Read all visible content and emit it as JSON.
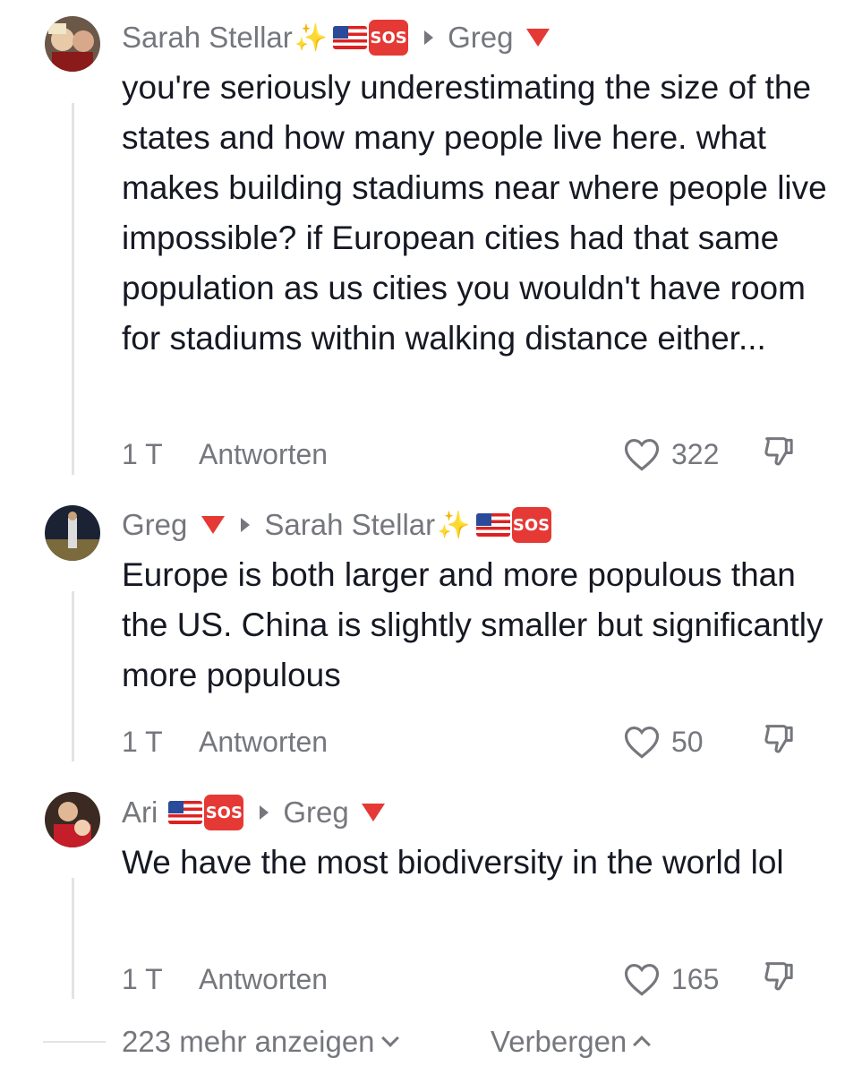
{
  "comments": [
    {
      "author": "Sarah Stellar",
      "reply_to": "Greg",
      "text": "you're seriously underestimating the size of the states and how many people live here. what makes building stadiums near where people live impossible? if European cities had that same population as us cities you wouldn't have room for stadiums within walking distance either...",
      "time": "1 T",
      "reply_label": "Antworten",
      "likes": "322"
    },
    {
      "author": "Greg",
      "reply_to": "Sarah Stellar",
      "text": "Europe is both larger and more populous than the US. China is slightly smaller but significantly more populous",
      "time": "1 T",
      "reply_label": "Antworten",
      "likes": "50"
    },
    {
      "author": "Ari",
      "reply_to": "Greg",
      "text": "We have the most biodiversity in the world lol",
      "time": "1 T",
      "reply_label": "Antworten",
      "likes": "165"
    }
  ],
  "badges": {
    "sos": "SOS",
    "sparkle": "✨"
  },
  "footer": {
    "more": "223 mehr anzeigen",
    "hide": "Verbergen"
  },
  "colors": {
    "muted": "#75777d",
    "text": "#161823",
    "sos": "#e53935",
    "line": "#e3e3e4"
  }
}
